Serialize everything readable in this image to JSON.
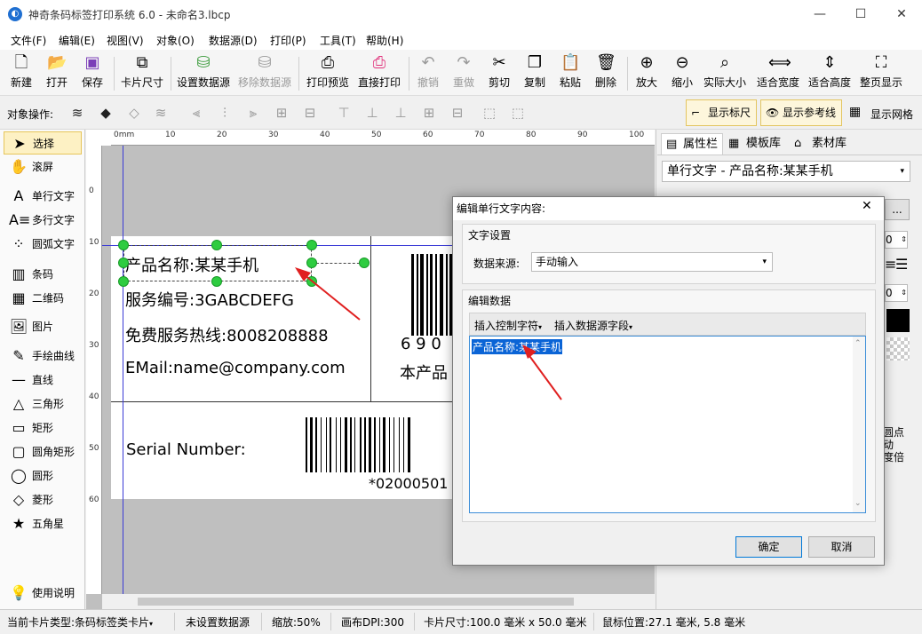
{
  "window": {
    "title": "神奇条码标签打印系统 6.0 - 未命名3.lbcp",
    "app_icon": "app-logo-icon",
    "controls": {
      "minimize": "—",
      "maximize": "☐",
      "close": "✕"
    }
  },
  "menu": [
    "文件(F)",
    "编辑(E)",
    "视图(V)",
    "对象(O)",
    "数据源(D)",
    "打印(P)",
    "工具(T)",
    "帮助(H)"
  ],
  "toolbar": {
    "new": "新建",
    "open": "打开",
    "save": "保存",
    "card_size": "卡片尺寸",
    "set_datasource": "设置数据源",
    "remove_datasource": "移除数据源",
    "print_preview": "打印预览",
    "direct_print": "直接打印",
    "undo": "撤销",
    "redo": "重做",
    "cut": "剪切",
    "copy": "复制",
    "paste": "粘贴",
    "delete": "删除",
    "zoom_in": "放大",
    "zoom_out": "缩小",
    "actual_size": "实际大小",
    "fit_width": "适合宽度",
    "fit_height": "适合高度",
    "fit_page": "整页显示"
  },
  "ops_bar": {
    "label": "对象操作:",
    "show_ruler": "显示标尺",
    "show_guides": "显示参考线",
    "show_grid": "显示网格"
  },
  "tools": {
    "select": "选择",
    "scroll": "滚屏",
    "single_text": "单行文字",
    "multi_text": "多行文字",
    "arc_text": "圆弧文字",
    "barcode": "条码",
    "qrcode": "二维码",
    "image": "图片",
    "freehand": "手绘曲线",
    "line": "直线",
    "triangle": "三角形",
    "rectangle": "矩形",
    "rounded_rect": "圆角矩形",
    "circle": "圆形",
    "diamond": "菱形",
    "star": "五角星",
    "help": "使用说明"
  },
  "rulers": {
    "h_labels": [
      "0mm",
      "10",
      "20",
      "30",
      "40",
      "50",
      "60",
      "70",
      "80",
      "90",
      "100"
    ],
    "v_labels": [
      "0",
      "10",
      "20",
      "30",
      "40",
      "50",
      "60"
    ]
  },
  "label": {
    "product_name": "产品名称:某某手机",
    "service_no": "服务编号:3GABCDEFG",
    "hotline": "免费服务热线:8008208888",
    "email": "EMail:name@company.com",
    "serial_label": "Serial Number:",
    "barcode1_digits": "6 9 0",
    "barcode1_caption": "本产品",
    "barcode2_text": "*02000501"
  },
  "right_panel": {
    "tabs": [
      "属性栏",
      "模板库",
      "素材库"
    ],
    "selected_object": "单行文字 - 产品名称:某某手机",
    "more_button": "...",
    "spin1": "0",
    "spin2": "0",
    "partial_labels": [
      "圆点",
      "动",
      "度倍"
    ]
  },
  "dialog": {
    "title": "编辑单行文字内容:",
    "text_settings": "文字设置",
    "datasource_label": "数据来源:",
    "datasource_value": "手动输入",
    "edit_data": "编辑数据",
    "insert_control": "插入控制字符",
    "insert_field": "插入数据源字段",
    "content": "产品名称:某某手机",
    "ok": "确定",
    "cancel": "取消"
  },
  "status": {
    "card_type": "当前卡片类型:条码标签类卡片",
    "datasource": "未设置数据源",
    "zoom": "缩放:50%",
    "dpi": "画布DPI:300",
    "card_size": "卡片尺寸:100.0 毫米 x 50.0 毫米",
    "mouse_pos": "鼠标位置:27.1 毫米, 5.8 毫米"
  },
  "colors": {
    "accent": "#1f6fd1",
    "selection_handle": "#2ecc40",
    "highlight": "#0a64d6",
    "arrow": "#e02020"
  }
}
